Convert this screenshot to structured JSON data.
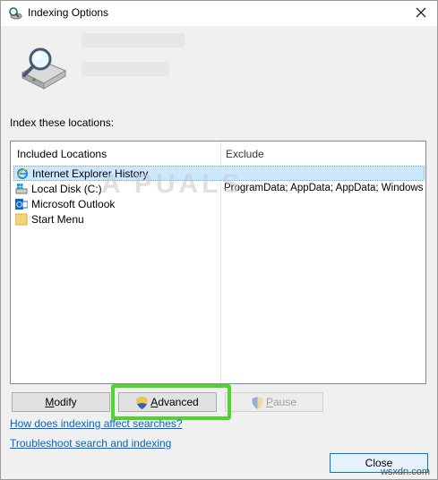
{
  "window": {
    "title": "Indexing Options"
  },
  "section_label": "Index these locations:",
  "columns": {
    "included": "Included Locations",
    "exclude": "Exclude"
  },
  "locations": [
    {
      "label": "Internet Explorer History",
      "exclude": "",
      "icon": "ie-icon",
      "selected": true
    },
    {
      "label": "Local Disk (C:)",
      "exclude": "ProgramData; AppData; AppData; Windows",
      "icon": "drive-icon",
      "selected": false
    },
    {
      "label": "Microsoft Outlook",
      "exclude": "",
      "icon": "outlook-icon",
      "selected": false
    },
    {
      "label": "Start Menu",
      "exclude": "",
      "icon": "folder-icon",
      "selected": false
    }
  ],
  "buttons": {
    "modify_accel": "M",
    "modify_rest": "odify",
    "advanced_accel": "A",
    "advanced_rest": "dvanced",
    "pause_accel": "P",
    "pause_rest": "ause",
    "close": "Close"
  },
  "links": {
    "how": "How does indexing affect searches?",
    "trouble": "Troubleshoot search and indexing"
  },
  "watermark": "A PUALS",
  "source_mark": "wsxdn.com",
  "colors": {
    "highlight": "#4fd32f",
    "selection": "#cce8ff",
    "link": "#0066cc"
  }
}
